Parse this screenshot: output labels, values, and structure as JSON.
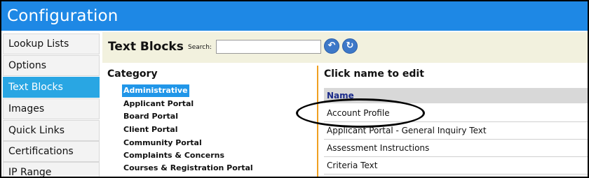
{
  "app": {
    "title": "Configuration"
  },
  "sidebar": {
    "items": [
      {
        "label": "Lookup Lists"
      },
      {
        "label": "Options"
      },
      {
        "label": "Text Blocks"
      },
      {
        "label": "Images"
      },
      {
        "label": "Quick Links"
      },
      {
        "label": "Certifications"
      },
      {
        "label": "IP Range"
      }
    ],
    "active_index": 2
  },
  "toolbar": {
    "title": "Text Blocks",
    "search_label": "Search:",
    "search_value": "",
    "search_placeholder": ""
  },
  "category": {
    "heading": "Category",
    "items": [
      "Administrative",
      "Applicant Portal",
      "Board Portal",
      "Client Portal",
      "Community Portal",
      "Complaints & Concerns",
      "Courses & Registration Portal"
    ],
    "selected": "Administrative"
  },
  "text_blocks": {
    "heading": "Click name to edit",
    "column": "Name",
    "rows": [
      "Account Profile",
      "Applicant Portal - General Inquiry Text",
      "Assessment Instructions",
      "Criteria Text"
    ]
  },
  "colors": {
    "title_bar": "#1e88e5",
    "sidebar_active": "#29a6e3",
    "category_active": "#2196e8",
    "toolbar_bg": "#f2f1de",
    "divider": "#f0a020"
  }
}
